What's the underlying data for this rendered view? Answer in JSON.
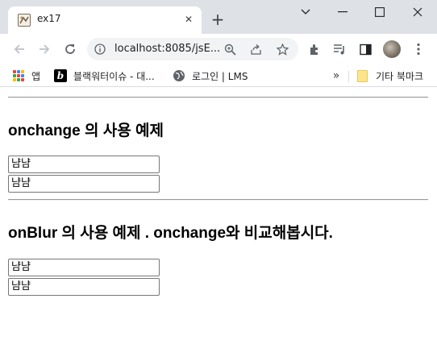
{
  "browser": {
    "tab": {
      "title": "ex17"
    },
    "address_bar": {
      "url": "localhost:8085/jsE..."
    },
    "bookmarks": [
      {
        "label": "앱"
      },
      {
        "label": "블랙워터이슈 - 대..."
      },
      {
        "label": "로그인 | LMS"
      }
    ],
    "other_bookmarks": "기타 북마크",
    "more_bookmarks": "»",
    "new_tab": "+"
  },
  "page": {
    "section1": {
      "heading": "onchange 의 사용 예제",
      "inputs": [
        {
          "value": "냠냠"
        },
        {
          "value": "냠냠"
        }
      ]
    },
    "section2": {
      "heading": "onBlur 의 사용 예제 . onchange와 비교해봅시다.",
      "inputs": [
        {
          "value": "냠냠"
        },
        {
          "value": "냠냠"
        }
      ]
    }
  },
  "colors": {
    "tab_strip": "#dee1e6",
    "omnibox": "#f1f3f4",
    "folder": "#fce58c"
  },
  "icons": [
    "close-icon",
    "plus-icon",
    "chevron-down-icon",
    "minimize-icon",
    "maximize-icon",
    "window-close-icon",
    "back-arrow-icon",
    "forward-arrow-icon",
    "reload-icon",
    "site-info-icon",
    "zoom-icon",
    "share-icon",
    "star-icon",
    "extensions-icon",
    "media-icon",
    "side-panel-icon",
    "avatar",
    "kebab-menu-icon",
    "apps-grid-icon",
    "globe-icon",
    "folder-icon"
  ]
}
